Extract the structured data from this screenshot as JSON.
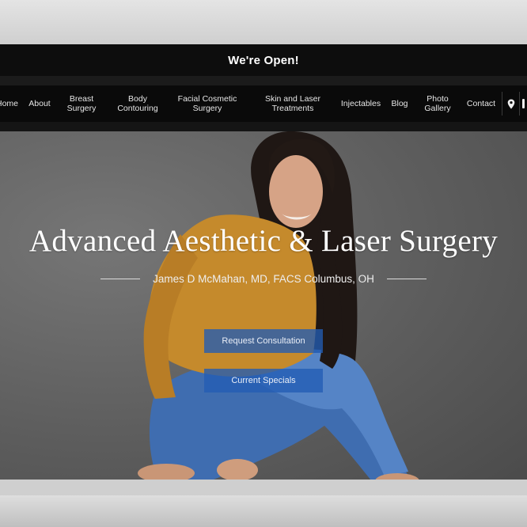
{
  "announcement": {
    "text": "We're Open!"
  },
  "nav": {
    "items": [
      {
        "label": "Home"
      },
      {
        "label": "About"
      },
      {
        "label": "Breast Surgery"
      },
      {
        "label": "Body Contouring"
      },
      {
        "label": "Facial Cosmetic Surgery"
      },
      {
        "label": "Skin and Laser Treatments"
      },
      {
        "label": "Injectables"
      },
      {
        "label": "Blog"
      },
      {
        "label": "Photo Gallery"
      },
      {
        "label": "Contact"
      }
    ],
    "icons": [
      "location-pin-icon",
      "phone-icon"
    ]
  },
  "hero": {
    "title": "Advanced Aesthetic & Laser Surgery",
    "subtitle": "James D McMahan, MD, FACS Columbus, OH",
    "buttons": {
      "consultation": "Request Consultation",
      "specials": "Current Specials"
    }
  },
  "colors": {
    "announce_bg": "#0d0d0d",
    "nav_bg": "#0a0a0a",
    "cta_blue": "#225cb4",
    "hero_wall": "#5d5d5d"
  }
}
